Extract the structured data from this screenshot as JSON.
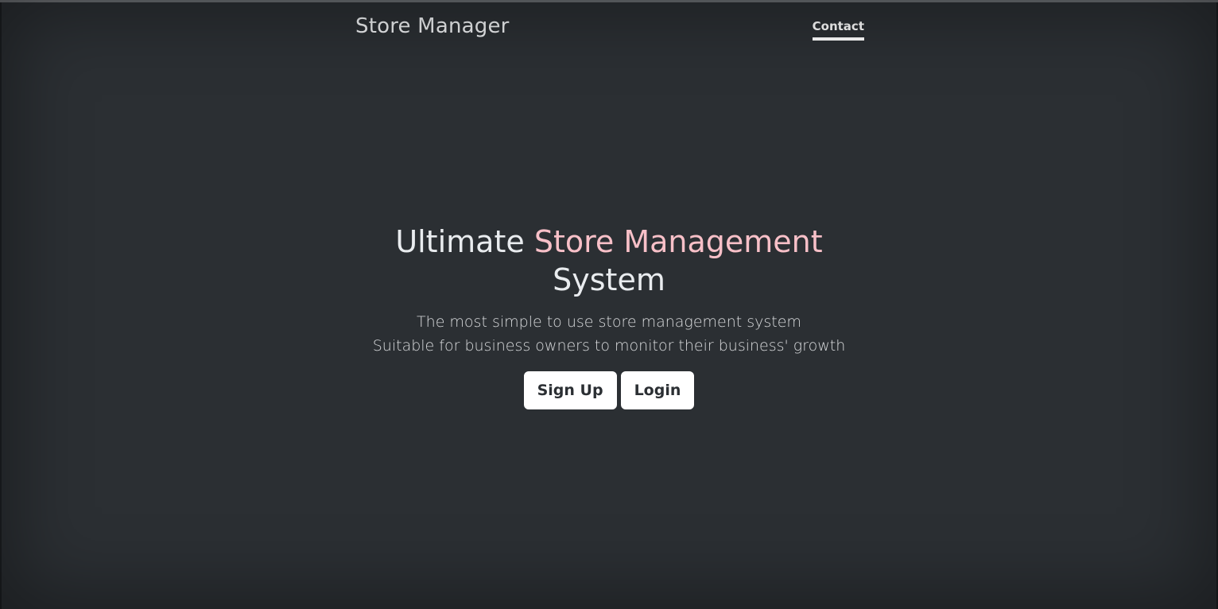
{
  "nav": {
    "brand": "Store Manager",
    "links": [
      {
        "label": "Contact",
        "active": true
      }
    ]
  },
  "hero": {
    "title_prefix": "Ultimate",
    "title_accent": "Store Management",
    "title_suffix": "System",
    "lead_line_1": "The most simple to use store management system",
    "lead_line_2": "Suitable for business owners to monitor their business' growth",
    "buttons": {
      "signup": "Sign Up",
      "login": "Login"
    }
  },
  "colors": {
    "background": "#2b2f33",
    "accent": "#f8c0c8",
    "text": "#e9ecef",
    "button_bg": "#ffffff",
    "button_text": "#2b2f33"
  }
}
